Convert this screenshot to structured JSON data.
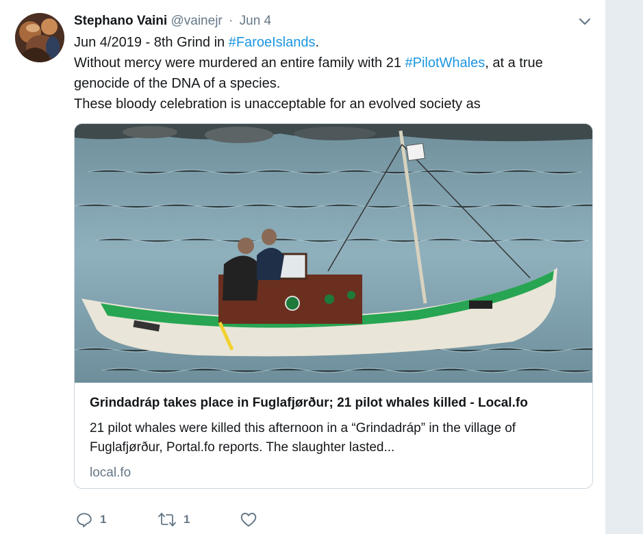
{
  "tweet": {
    "author": {
      "display_name": "Stephano Vaini",
      "handle": "@vainejr",
      "separator": "·",
      "date": "Jun 4",
      "avatar_icon": "profile-photo"
    },
    "text": {
      "line1_prefix": "Jun 4/2019 - 8th Grind in ",
      "line1_hashtag": "#FaroeIslands",
      "line1_suffix": ".",
      "line2_prefix": "Without mercy were murdered an entire family with 21 ",
      "line2_hashtag": "#PilotWhales",
      "line2_suffix": ", at a true",
      "line3": "genocide of the DNA of a species.",
      "line4": "These bloody celebration is unacceptable for an evolved society as"
    },
    "card": {
      "image_icon": "boat-photo",
      "title": "Grindadráp takes place in Fuglafjørður; 21 pilot whales killed - Local.fo",
      "description_line1": "21 pilot whales were killed this afternoon in a “Grindadráp” in the village of",
      "description_line2": "Fuglafjørður, Portal.fo reports. The slaughter lasted...",
      "domain": "local.fo"
    },
    "actions": {
      "reply_count": "1",
      "retweet_count": "1",
      "reply_icon": "reply-icon",
      "retweet_icon": "retweet-icon",
      "like_icon": "heart-icon",
      "more_icon": "chevron-down-icon"
    }
  },
  "colors": {
    "link": "#1b95e0",
    "text": "#14171a",
    "muted": "#657786",
    "border": "#ccd6dd",
    "rail": "#e6ecf0",
    "boat_hull_green": "#27a552",
    "water": "#7d9fae"
  }
}
